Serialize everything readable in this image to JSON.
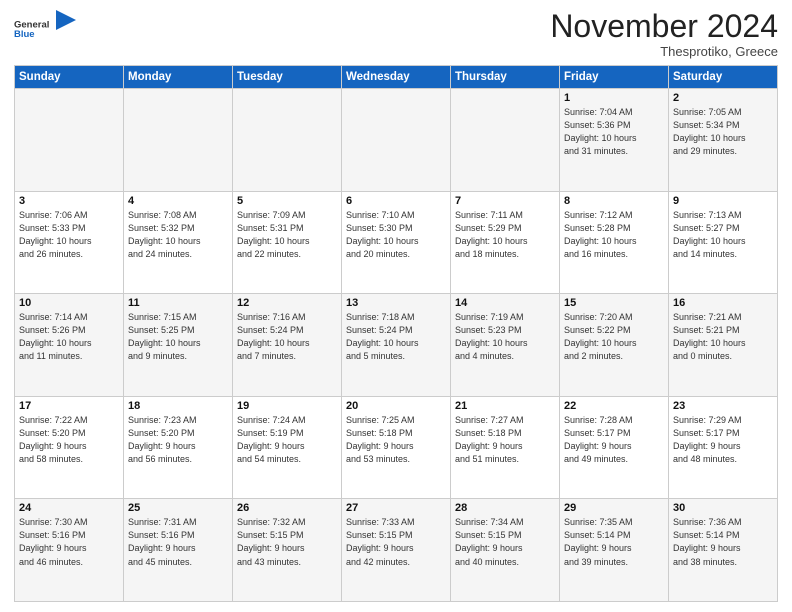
{
  "header": {
    "logo": {
      "general": "General",
      "blue": "Blue"
    },
    "month": "November 2024",
    "location": "Thesprotiko, Greece"
  },
  "weekdays": [
    "Sunday",
    "Monday",
    "Tuesday",
    "Wednesday",
    "Thursday",
    "Friday",
    "Saturday"
  ],
  "weeks": [
    [
      {
        "day": "",
        "info": ""
      },
      {
        "day": "",
        "info": ""
      },
      {
        "day": "",
        "info": ""
      },
      {
        "day": "",
        "info": ""
      },
      {
        "day": "",
        "info": ""
      },
      {
        "day": "1",
        "info": "Sunrise: 7:04 AM\nSunset: 5:36 PM\nDaylight: 10 hours\nand 31 minutes."
      },
      {
        "day": "2",
        "info": "Sunrise: 7:05 AM\nSunset: 5:34 PM\nDaylight: 10 hours\nand 29 minutes."
      }
    ],
    [
      {
        "day": "3",
        "info": "Sunrise: 7:06 AM\nSunset: 5:33 PM\nDaylight: 10 hours\nand 26 minutes."
      },
      {
        "day": "4",
        "info": "Sunrise: 7:08 AM\nSunset: 5:32 PM\nDaylight: 10 hours\nand 24 minutes."
      },
      {
        "day": "5",
        "info": "Sunrise: 7:09 AM\nSunset: 5:31 PM\nDaylight: 10 hours\nand 22 minutes."
      },
      {
        "day": "6",
        "info": "Sunrise: 7:10 AM\nSunset: 5:30 PM\nDaylight: 10 hours\nand 20 minutes."
      },
      {
        "day": "7",
        "info": "Sunrise: 7:11 AM\nSunset: 5:29 PM\nDaylight: 10 hours\nand 18 minutes."
      },
      {
        "day": "8",
        "info": "Sunrise: 7:12 AM\nSunset: 5:28 PM\nDaylight: 10 hours\nand 16 minutes."
      },
      {
        "day": "9",
        "info": "Sunrise: 7:13 AM\nSunset: 5:27 PM\nDaylight: 10 hours\nand 14 minutes."
      }
    ],
    [
      {
        "day": "10",
        "info": "Sunrise: 7:14 AM\nSunset: 5:26 PM\nDaylight: 10 hours\nand 11 minutes."
      },
      {
        "day": "11",
        "info": "Sunrise: 7:15 AM\nSunset: 5:25 PM\nDaylight: 10 hours\nand 9 minutes."
      },
      {
        "day": "12",
        "info": "Sunrise: 7:16 AM\nSunset: 5:24 PM\nDaylight: 10 hours\nand 7 minutes."
      },
      {
        "day": "13",
        "info": "Sunrise: 7:18 AM\nSunset: 5:24 PM\nDaylight: 10 hours\nand 5 minutes."
      },
      {
        "day": "14",
        "info": "Sunrise: 7:19 AM\nSunset: 5:23 PM\nDaylight: 10 hours\nand 4 minutes."
      },
      {
        "day": "15",
        "info": "Sunrise: 7:20 AM\nSunset: 5:22 PM\nDaylight: 10 hours\nand 2 minutes."
      },
      {
        "day": "16",
        "info": "Sunrise: 7:21 AM\nSunset: 5:21 PM\nDaylight: 10 hours\nand 0 minutes."
      }
    ],
    [
      {
        "day": "17",
        "info": "Sunrise: 7:22 AM\nSunset: 5:20 PM\nDaylight: 9 hours\nand 58 minutes."
      },
      {
        "day": "18",
        "info": "Sunrise: 7:23 AM\nSunset: 5:20 PM\nDaylight: 9 hours\nand 56 minutes."
      },
      {
        "day": "19",
        "info": "Sunrise: 7:24 AM\nSunset: 5:19 PM\nDaylight: 9 hours\nand 54 minutes."
      },
      {
        "day": "20",
        "info": "Sunrise: 7:25 AM\nSunset: 5:18 PM\nDaylight: 9 hours\nand 53 minutes."
      },
      {
        "day": "21",
        "info": "Sunrise: 7:27 AM\nSunset: 5:18 PM\nDaylight: 9 hours\nand 51 minutes."
      },
      {
        "day": "22",
        "info": "Sunrise: 7:28 AM\nSunset: 5:17 PM\nDaylight: 9 hours\nand 49 minutes."
      },
      {
        "day": "23",
        "info": "Sunrise: 7:29 AM\nSunset: 5:17 PM\nDaylight: 9 hours\nand 48 minutes."
      }
    ],
    [
      {
        "day": "24",
        "info": "Sunrise: 7:30 AM\nSunset: 5:16 PM\nDaylight: 9 hours\nand 46 minutes."
      },
      {
        "day": "25",
        "info": "Sunrise: 7:31 AM\nSunset: 5:16 PM\nDaylight: 9 hours\nand 45 minutes."
      },
      {
        "day": "26",
        "info": "Sunrise: 7:32 AM\nSunset: 5:15 PM\nDaylight: 9 hours\nand 43 minutes."
      },
      {
        "day": "27",
        "info": "Sunrise: 7:33 AM\nSunset: 5:15 PM\nDaylight: 9 hours\nand 42 minutes."
      },
      {
        "day": "28",
        "info": "Sunrise: 7:34 AM\nSunset: 5:15 PM\nDaylight: 9 hours\nand 40 minutes."
      },
      {
        "day": "29",
        "info": "Sunrise: 7:35 AM\nSunset: 5:14 PM\nDaylight: 9 hours\nand 39 minutes."
      },
      {
        "day": "30",
        "info": "Sunrise: 7:36 AM\nSunset: 5:14 PM\nDaylight: 9 hours\nand 38 minutes."
      }
    ]
  ]
}
